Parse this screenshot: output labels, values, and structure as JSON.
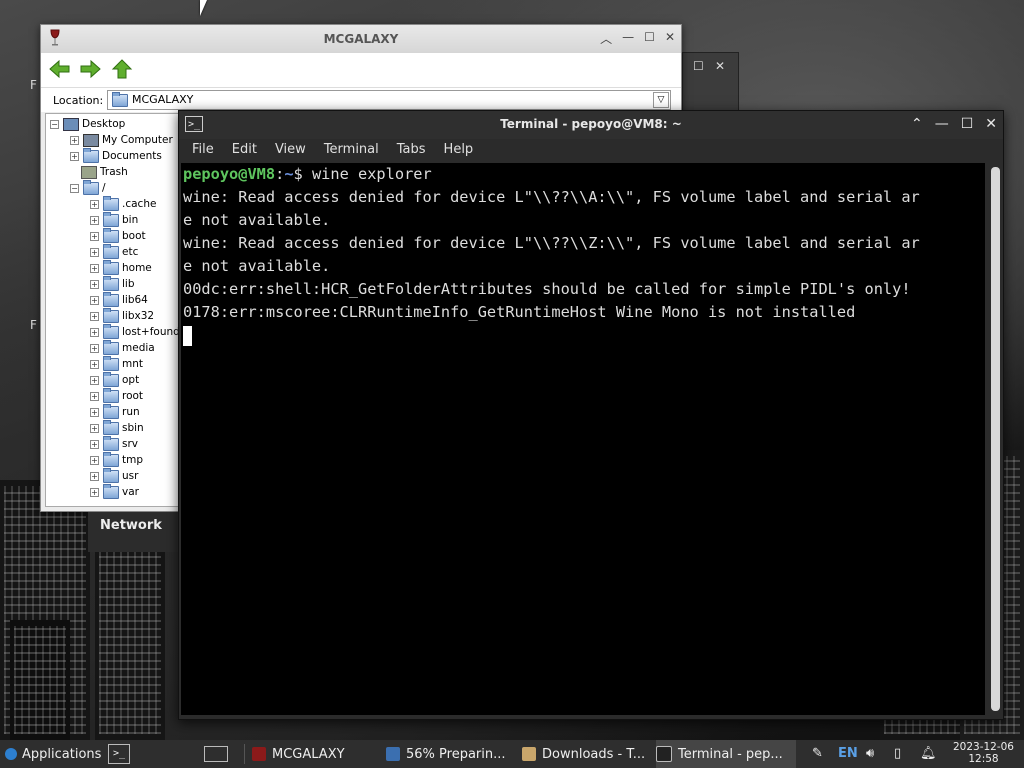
{
  "colors": {
    "terminal_bg": "#000000",
    "prompt_user": "#5ec55e",
    "prompt_path": "#6a8fdc",
    "taskbar_bg": "#2e2e2e"
  },
  "explorer": {
    "title": "MCGALAXY",
    "location_label": "Location:",
    "location_value": "MCGALAXY",
    "tree": [
      {
        "label": "Desktop",
        "icon": "desktop-icon",
        "expander": "−",
        "depth": 0
      },
      {
        "label": "My Computer",
        "icon": "computer-icon",
        "expander": "+",
        "depth": 1
      },
      {
        "label": "Documents",
        "icon": "folder-icon",
        "expander": "+",
        "depth": 1
      },
      {
        "label": "Trash",
        "icon": "trash-icon",
        "expander": "",
        "depth": 1
      },
      {
        "label": "/",
        "icon": "folder-icon",
        "expander": "−",
        "depth": 1
      },
      {
        "label": ".cache",
        "icon": "folder-icon",
        "expander": "+",
        "depth": 2
      },
      {
        "label": "bin",
        "icon": "folder-icon",
        "expander": "+",
        "depth": 2
      },
      {
        "label": "boot",
        "icon": "folder-icon",
        "expander": "+",
        "depth": 2
      },
      {
        "label": "etc",
        "icon": "folder-icon",
        "expander": "+",
        "depth": 2
      },
      {
        "label": "home",
        "icon": "folder-icon",
        "expander": "+",
        "depth": 2
      },
      {
        "label": "lib",
        "icon": "folder-icon",
        "expander": "+",
        "depth": 2
      },
      {
        "label": "lib64",
        "icon": "folder-icon",
        "expander": "+",
        "depth": 2
      },
      {
        "label": "libx32",
        "icon": "folder-icon",
        "expander": "+",
        "depth": 2
      },
      {
        "label": "lost+found",
        "icon": "folder-icon",
        "expander": "+",
        "depth": 2
      },
      {
        "label": "media",
        "icon": "folder-icon",
        "expander": "+",
        "depth": 2
      },
      {
        "label": "mnt",
        "icon": "folder-icon",
        "expander": "+",
        "depth": 2
      },
      {
        "label": "opt",
        "icon": "folder-icon",
        "expander": "+",
        "depth": 2
      },
      {
        "label": "root",
        "icon": "folder-icon",
        "expander": "+",
        "depth": 2
      },
      {
        "label": "run",
        "icon": "folder-icon",
        "expander": "+",
        "depth": 2
      },
      {
        "label": "sbin",
        "icon": "folder-icon",
        "expander": "+",
        "depth": 2
      },
      {
        "label": "srv",
        "icon": "folder-icon",
        "expander": "+",
        "depth": 2
      },
      {
        "label": "tmp",
        "icon": "folder-icon",
        "expander": "+",
        "depth": 2
      },
      {
        "label": "usr",
        "icon": "folder-icon",
        "expander": "+",
        "depth": 2
      },
      {
        "label": "var",
        "icon": "folder-icon",
        "expander": "+",
        "depth": 2
      }
    ]
  },
  "network_panel": {
    "title": "Network"
  },
  "terminal": {
    "title": "Terminal - pepoyo@VM8: ~",
    "menu": [
      "File",
      "Edit",
      "View",
      "Terminal",
      "Tabs",
      "Help"
    ],
    "prompt_user": "pepoyo@VM8",
    "prompt_sep": ":",
    "prompt_path": "~",
    "prompt_end": "$ ",
    "command": "wine explorer",
    "output": [
      "wine: Read access denied for device L\"\\\\??\\\\A:\\\\\", FS volume label and serial ar",
      "e not available.",
      "wine: Read access denied for device L\"\\\\??\\\\Z:\\\\\", FS volume label and serial ar",
      "e not available.",
      "00dc:err:shell:HCR_GetFolderAttributes should be called for simple PIDL's only!",
      "0178:err:mscoree:CLRRuntimeInfo_GetRuntimeHost Wine Mono is not installed"
    ]
  },
  "taskbar": {
    "applications": "Applications",
    "tasks": [
      {
        "label": "MCGALAXY",
        "icon": "wine-icon"
      },
      {
        "label": "56% Preparin...",
        "icon": "install-icon"
      },
      {
        "label": "Downloads - T...",
        "icon": "folder-icon"
      },
      {
        "label": "Terminal - pep...",
        "icon": "terminal-icon"
      }
    ],
    "keyboard_layout": "EN",
    "date": "2023-12-06",
    "time": "12:58"
  }
}
